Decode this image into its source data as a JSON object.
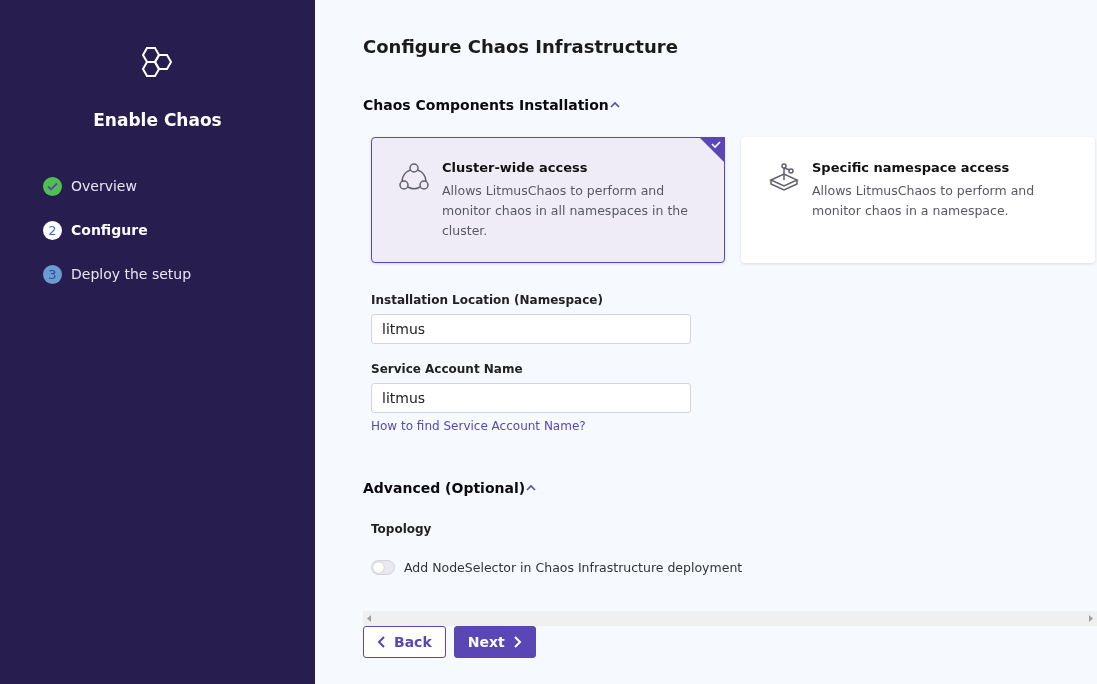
{
  "sidebar": {
    "title": "Enable Chaos",
    "steps": [
      {
        "label": "Overview",
        "completed": true,
        "selected": false
      },
      {
        "label": "Configure",
        "number": "2",
        "completed": false,
        "selected": true
      },
      {
        "label": "Deploy the setup",
        "number": "3",
        "completed": false,
        "selected": false
      }
    ]
  },
  "main": {
    "title": "Configure Chaos Infrastructure",
    "installation": {
      "heading": "Chaos Components Installation",
      "expanded": true,
      "options": [
        {
          "kind": "cluster",
          "title": "Cluster-wide access",
          "description": "Allows LitmusChaos to perform and monitor chaos in all namespaces in the cluster.",
          "selected": true
        },
        {
          "kind": "namespace",
          "title": "Specific namespace access",
          "description": "Allows LitmusChaos to perform and monitor chaos in a namespace.",
          "selected": false
        }
      ],
      "fields": [
        {
          "label": "Installation Location (Namespace)",
          "value": "litmus"
        },
        {
          "label": "Service Account Name",
          "value": "litmus",
          "help_link": "How to find Service Account Name?"
        }
      ]
    },
    "advanced": {
      "heading": "Advanced (Optional)",
      "expanded": true,
      "subheading": "Topology",
      "toggle": {
        "label": "Add NodeSelector in Chaos Infrastructure deployment",
        "on": false
      }
    },
    "buttons": {
      "back": "Back",
      "next": "Next"
    }
  }
}
